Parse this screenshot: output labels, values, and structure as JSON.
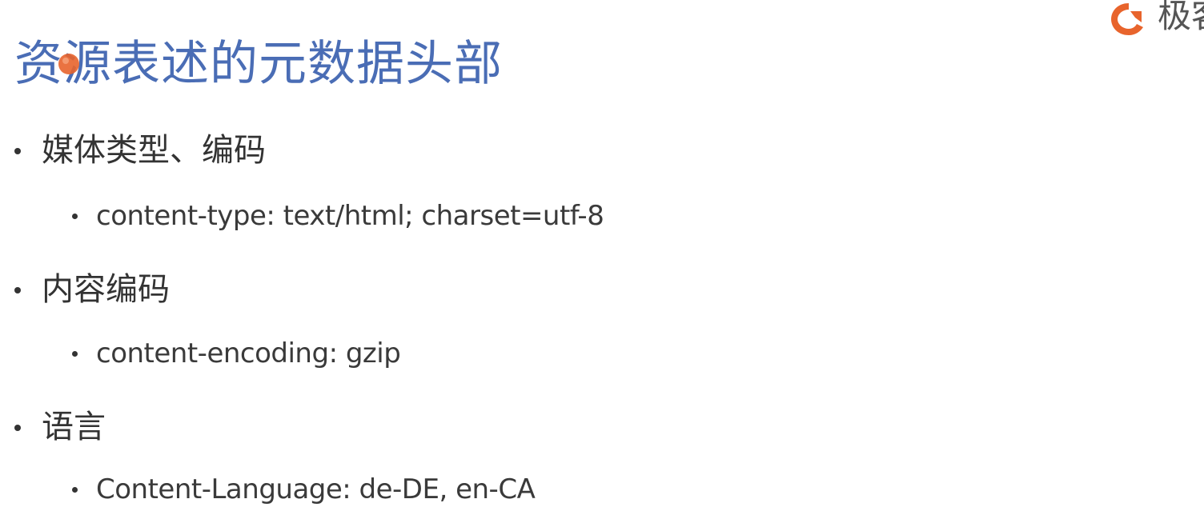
{
  "slide": {
    "title": "资源表述的元数据头部",
    "logo_text": "极客",
    "sections": [
      {
        "heading": "媒体类型、编码",
        "detail": "content-type: text/html; charset=utf-8"
      },
      {
        "heading": "内容编码",
        "detail": "content-encoding: gzip"
      },
      {
        "heading": "语言",
        "detail": "Content-Language: de-DE, en-CA"
      }
    ]
  },
  "colors": {
    "title": "#4a6db5",
    "body_text": "#333333",
    "accent": "#e8642c"
  },
  "icons": {
    "logo": "geek-logo-icon",
    "pointer": "laser-pointer-icon"
  }
}
